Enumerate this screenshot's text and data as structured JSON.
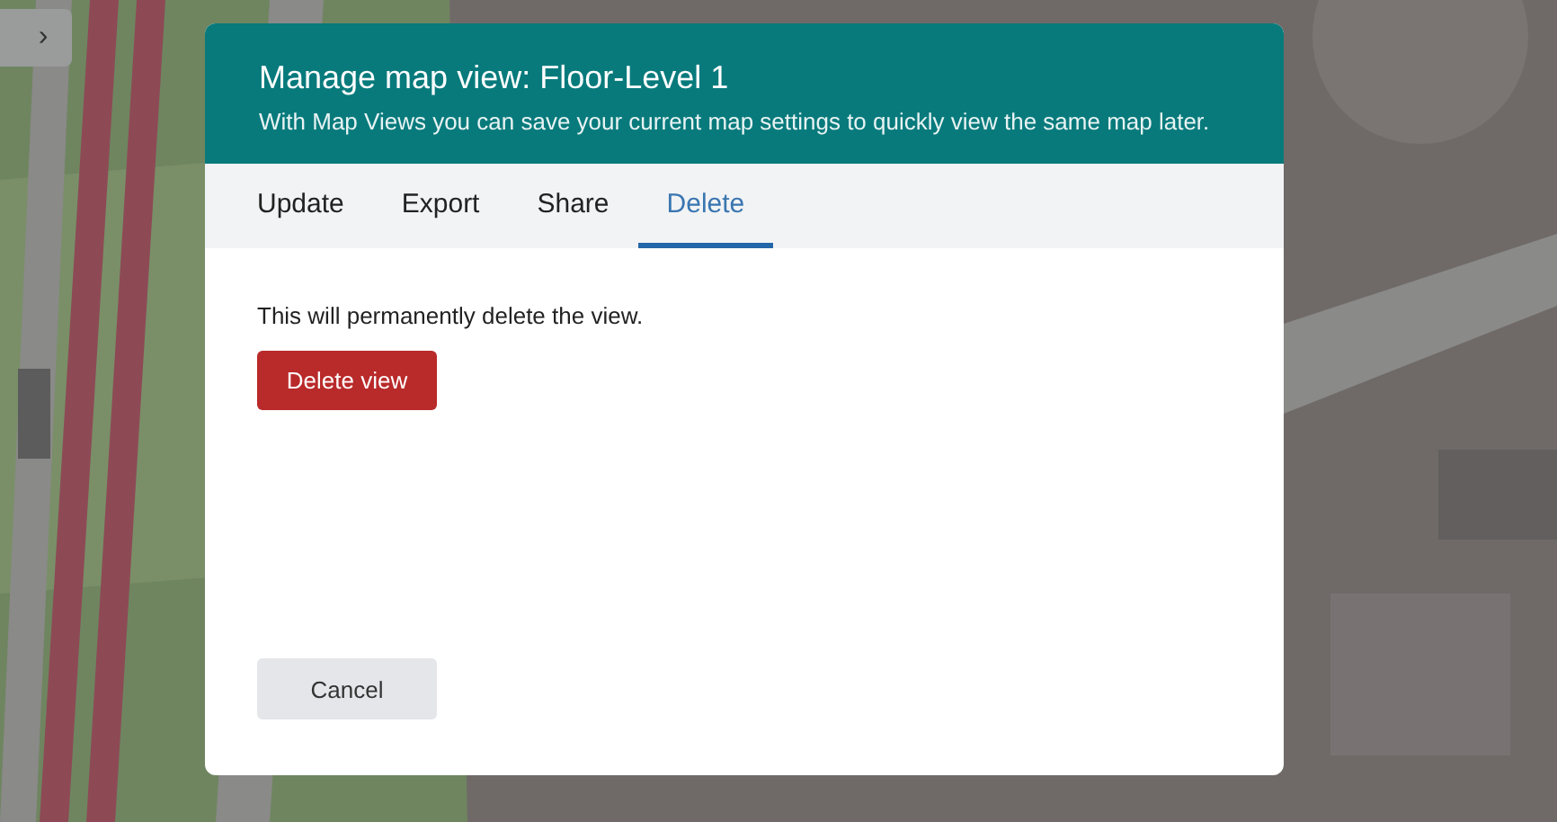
{
  "sidebar_toggle": {
    "label": "›"
  },
  "dialog": {
    "title": "Manage map view: Floor-Level 1",
    "subtitle": "With Map Views you can save your current map settings to quickly view the same map later.",
    "tabs": [
      {
        "label": "Update",
        "selected": false
      },
      {
        "label": "Export",
        "selected": false
      },
      {
        "label": "Share",
        "selected": false
      },
      {
        "label": "Delete",
        "selected": true
      }
    ],
    "message": "This will permanently delete the view.",
    "delete_button": "Delete view",
    "cancel_button": "Cancel"
  }
}
